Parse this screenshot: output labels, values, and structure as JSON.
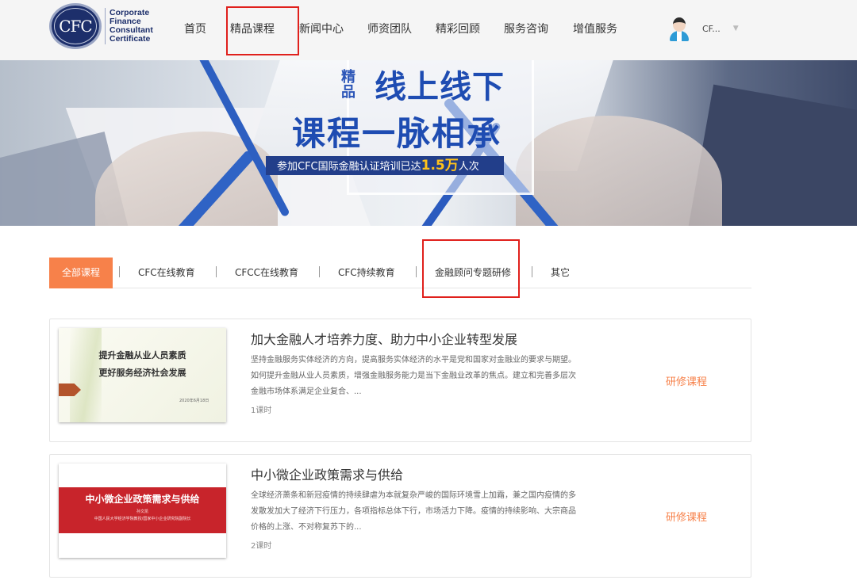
{
  "header": {
    "logo": {
      "mark": "CFC",
      "lines": [
        "Corporate",
        "Finance",
        "Consultant",
        "Certificate"
      ]
    },
    "nav": [
      {
        "label": "首页"
      },
      {
        "label": "精品课程"
      },
      {
        "label": "新闻中心"
      },
      {
        "label": "师资团队"
      },
      {
        "label": "精彩回顾"
      },
      {
        "label": "服务咨询"
      },
      {
        "label": "增值服务"
      }
    ],
    "user": {
      "name": "CF...",
      "caret": "▼"
    }
  },
  "banner": {
    "badge": "精品",
    "line1": "线上线下",
    "line2": "课程一脉相承",
    "strip_prefix": "参加CFC国际金融认证培训已达",
    "strip_number": "1.5万",
    "strip_suffix": "人次"
  },
  "tabs": [
    {
      "label": "全部课程"
    },
    {
      "label": "CFC在线教育"
    },
    {
      "label": "CFCC在线教育"
    },
    {
      "label": "CFC持续教育"
    },
    {
      "label": "金融顾问专题研修"
    },
    {
      "label": "其它"
    }
  ],
  "tab_separator": "|",
  "courses": [
    {
      "title": "加大金融人才培养力度、助力中小企业转型发展",
      "desc": "坚持金融服务实体经济的方向，提高服务实体经济的水平是党和国家对金融业的要求与期望。如何提升金融从业人员素质，增强金融服务能力是当下金融业改革的焦点。建立和完善多层次金融市场体系满足企业复合、...",
      "hours": "1课时",
      "type": "研修课程",
      "thumb": {
        "line1": "提升金融从业人员素质",
        "line2": "更好服务经济社会发展",
        "date": "2020年6月18日"
      }
    },
    {
      "title": "中小微企业政策需求与供给",
      "desc": "全球经济萧条和新冠疫情的持续肆虐为本就复杂严峻的国际环境雪上加霜，兼之国内疫情的多发散发加大了经济下行压力，各项指标总体下行，市场活力下降。疫情的持续影响、大宗商品价格的上涨、不对称复苏下的...",
      "hours": "2课时",
      "type": "研修课程",
      "thumb": {
        "title": "中小微企业政策需求与供给",
        "author": "孙文凯",
        "affiliation": "中国人民大学经济学院教授/国家中小企业研究院副院长"
      }
    }
  ],
  "colors": {
    "accent": "#f7814a",
    "highlight": "#e0201c",
    "brand": "#1d2f6b",
    "banner_text": "#1e4cb2"
  }
}
